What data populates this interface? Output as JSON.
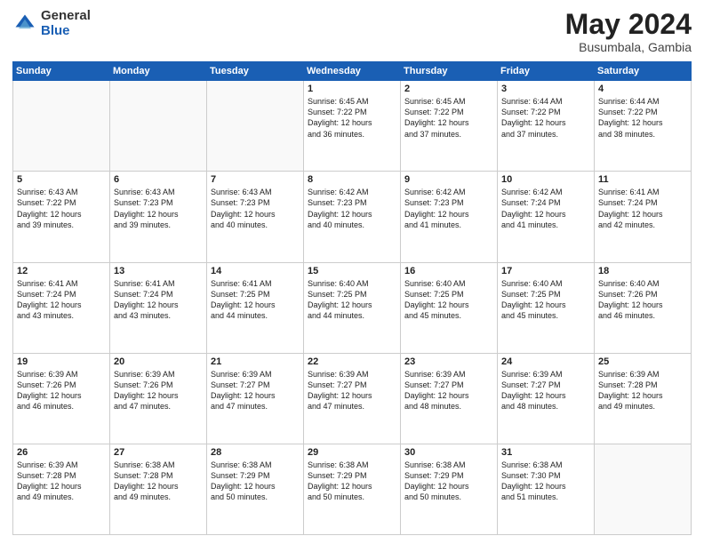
{
  "header": {
    "logo_general": "General",
    "logo_blue": "Blue",
    "month_title": "May 2024",
    "subtitle": "Busumbala, Gambia"
  },
  "weekdays": [
    "Sunday",
    "Monday",
    "Tuesday",
    "Wednesday",
    "Thursday",
    "Friday",
    "Saturday"
  ],
  "weeks": [
    [
      {
        "day": "",
        "info": ""
      },
      {
        "day": "",
        "info": ""
      },
      {
        "day": "",
        "info": ""
      },
      {
        "day": "1",
        "info": "Sunrise: 6:45 AM\nSunset: 7:22 PM\nDaylight: 12 hours\nand 36 minutes."
      },
      {
        "day": "2",
        "info": "Sunrise: 6:45 AM\nSunset: 7:22 PM\nDaylight: 12 hours\nand 37 minutes."
      },
      {
        "day": "3",
        "info": "Sunrise: 6:44 AM\nSunset: 7:22 PM\nDaylight: 12 hours\nand 37 minutes."
      },
      {
        "day": "4",
        "info": "Sunrise: 6:44 AM\nSunset: 7:22 PM\nDaylight: 12 hours\nand 38 minutes."
      }
    ],
    [
      {
        "day": "5",
        "info": "Sunrise: 6:43 AM\nSunset: 7:22 PM\nDaylight: 12 hours\nand 39 minutes."
      },
      {
        "day": "6",
        "info": "Sunrise: 6:43 AM\nSunset: 7:23 PM\nDaylight: 12 hours\nand 39 minutes."
      },
      {
        "day": "7",
        "info": "Sunrise: 6:43 AM\nSunset: 7:23 PM\nDaylight: 12 hours\nand 40 minutes."
      },
      {
        "day": "8",
        "info": "Sunrise: 6:42 AM\nSunset: 7:23 PM\nDaylight: 12 hours\nand 40 minutes."
      },
      {
        "day": "9",
        "info": "Sunrise: 6:42 AM\nSunset: 7:23 PM\nDaylight: 12 hours\nand 41 minutes."
      },
      {
        "day": "10",
        "info": "Sunrise: 6:42 AM\nSunset: 7:24 PM\nDaylight: 12 hours\nand 41 minutes."
      },
      {
        "day": "11",
        "info": "Sunrise: 6:41 AM\nSunset: 7:24 PM\nDaylight: 12 hours\nand 42 minutes."
      }
    ],
    [
      {
        "day": "12",
        "info": "Sunrise: 6:41 AM\nSunset: 7:24 PM\nDaylight: 12 hours\nand 43 minutes."
      },
      {
        "day": "13",
        "info": "Sunrise: 6:41 AM\nSunset: 7:24 PM\nDaylight: 12 hours\nand 43 minutes."
      },
      {
        "day": "14",
        "info": "Sunrise: 6:41 AM\nSunset: 7:25 PM\nDaylight: 12 hours\nand 44 minutes."
      },
      {
        "day": "15",
        "info": "Sunrise: 6:40 AM\nSunset: 7:25 PM\nDaylight: 12 hours\nand 44 minutes."
      },
      {
        "day": "16",
        "info": "Sunrise: 6:40 AM\nSunset: 7:25 PM\nDaylight: 12 hours\nand 45 minutes."
      },
      {
        "day": "17",
        "info": "Sunrise: 6:40 AM\nSunset: 7:25 PM\nDaylight: 12 hours\nand 45 minutes."
      },
      {
        "day": "18",
        "info": "Sunrise: 6:40 AM\nSunset: 7:26 PM\nDaylight: 12 hours\nand 46 minutes."
      }
    ],
    [
      {
        "day": "19",
        "info": "Sunrise: 6:39 AM\nSunset: 7:26 PM\nDaylight: 12 hours\nand 46 minutes."
      },
      {
        "day": "20",
        "info": "Sunrise: 6:39 AM\nSunset: 7:26 PM\nDaylight: 12 hours\nand 47 minutes."
      },
      {
        "day": "21",
        "info": "Sunrise: 6:39 AM\nSunset: 7:27 PM\nDaylight: 12 hours\nand 47 minutes."
      },
      {
        "day": "22",
        "info": "Sunrise: 6:39 AM\nSunset: 7:27 PM\nDaylight: 12 hours\nand 47 minutes."
      },
      {
        "day": "23",
        "info": "Sunrise: 6:39 AM\nSunset: 7:27 PM\nDaylight: 12 hours\nand 48 minutes."
      },
      {
        "day": "24",
        "info": "Sunrise: 6:39 AM\nSunset: 7:27 PM\nDaylight: 12 hours\nand 48 minutes."
      },
      {
        "day": "25",
        "info": "Sunrise: 6:39 AM\nSunset: 7:28 PM\nDaylight: 12 hours\nand 49 minutes."
      }
    ],
    [
      {
        "day": "26",
        "info": "Sunrise: 6:39 AM\nSunset: 7:28 PM\nDaylight: 12 hours\nand 49 minutes."
      },
      {
        "day": "27",
        "info": "Sunrise: 6:38 AM\nSunset: 7:28 PM\nDaylight: 12 hours\nand 49 minutes."
      },
      {
        "day": "28",
        "info": "Sunrise: 6:38 AM\nSunset: 7:29 PM\nDaylight: 12 hours\nand 50 minutes."
      },
      {
        "day": "29",
        "info": "Sunrise: 6:38 AM\nSunset: 7:29 PM\nDaylight: 12 hours\nand 50 minutes."
      },
      {
        "day": "30",
        "info": "Sunrise: 6:38 AM\nSunset: 7:29 PM\nDaylight: 12 hours\nand 50 minutes."
      },
      {
        "day": "31",
        "info": "Sunrise: 6:38 AM\nSunset: 7:30 PM\nDaylight: 12 hours\nand 51 minutes."
      },
      {
        "day": "",
        "info": ""
      }
    ]
  ]
}
